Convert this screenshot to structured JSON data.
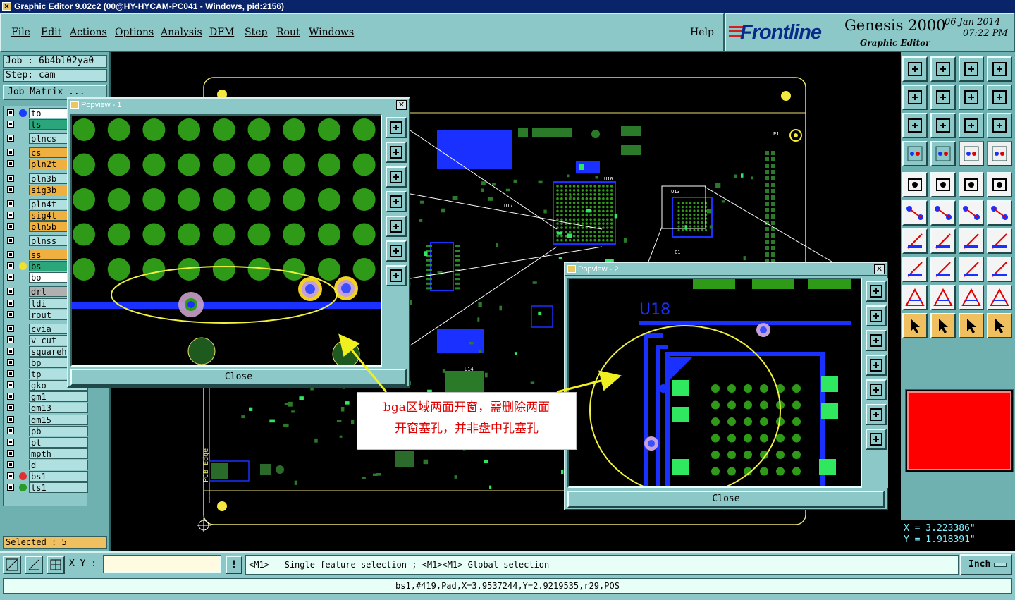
{
  "window": {
    "title": "Graphic Editor 9.02c2 (00@HY-HYCAM-PC041 - Windows, pid:2156)"
  },
  "menu": {
    "items": [
      "File",
      "Edit",
      "Actions",
      "Options",
      "Analysis",
      "DFM",
      "Step",
      "Rout",
      "Windows"
    ],
    "help": "Help"
  },
  "brand": {
    "logo": "Frontline",
    "product": "Genesis 2000",
    "subtitle": "Graphic Editor",
    "date": "06 Jan 2014",
    "time": "07:22 PM"
  },
  "job": {
    "job_label": "Job : 6b4bl02ya0",
    "step_label": "Step: cam",
    "matrix_button": "Job Matrix ..."
  },
  "layers": [
    {
      "name": "to",
      "bg": "#ffffff",
      "dot": "#1a3cff"
    },
    {
      "name": "ts",
      "bg": "#2aa67a",
      "dot": ""
    },
    {
      "name": "plncs",
      "bg": "#b0e0e0",
      "dot": ""
    },
    {
      "name": "cs",
      "bg": "#f0b040",
      "dot": ""
    },
    {
      "name": "pln2t",
      "bg": "#f0b040",
      "dot": ""
    },
    {
      "name": "pln3b",
      "bg": "#b0e0e0",
      "dot": ""
    },
    {
      "name": "sig3b",
      "bg": "#f0b040",
      "dot": ""
    },
    {
      "name": "pln4t",
      "bg": "#b0e0e0",
      "dot": ""
    },
    {
      "name": "sig4t",
      "bg": "#f0b040",
      "dot": ""
    },
    {
      "name": "pln5b",
      "bg": "#f0b040",
      "dot": ""
    },
    {
      "name": "plnss",
      "bg": "#b0e0e0",
      "dot": ""
    },
    {
      "name": "ss",
      "bg": "#f0b040",
      "dot": ""
    },
    {
      "name": "bs",
      "bg": "#2aa67a",
      "dot": "#f0e030"
    },
    {
      "name": "bo",
      "bg": "#ffffff",
      "dot": ""
    },
    {
      "name": "drl",
      "bg": "#b0b0b0",
      "dot": ""
    },
    {
      "name": "ldi",
      "bg": "#b0e0e0",
      "dot": ""
    },
    {
      "name": "rout",
      "bg": "#b0e0e0",
      "dot": ""
    },
    {
      "name": "cvia",
      "bg": "#b0e0e0",
      "dot": ""
    },
    {
      "name": "v-cut",
      "bg": "#b0e0e0",
      "dot": ""
    },
    {
      "name": "squarehole",
      "bg": "#b0e0e0",
      "dot": ""
    },
    {
      "name": "bp",
      "bg": "#b0e0e0",
      "dot": ""
    },
    {
      "name": "tp",
      "bg": "#b0e0e0",
      "dot": ""
    },
    {
      "name": "gko",
      "bg": "#b0e0e0",
      "dot": ""
    },
    {
      "name": "gm1",
      "bg": "#b0e0e0",
      "dot": ""
    },
    {
      "name": "gm13",
      "bg": "#b0e0e0",
      "dot": ""
    },
    {
      "name": "gm15",
      "bg": "#b0e0e0",
      "dot": ""
    },
    {
      "name": "pb",
      "bg": "#b0e0e0",
      "dot": ""
    },
    {
      "name": "pt",
      "bg": "#b0e0e0",
      "dot": ""
    },
    {
      "name": "mpth",
      "bg": "#b0e0e0",
      "dot": ""
    },
    {
      "name": "d",
      "bg": "#b0e0e0",
      "dot": ""
    },
    {
      "name": "bs1",
      "bg": "#b0e0e0",
      "dot": "#e03030"
    },
    {
      "name": "ts1",
      "bg": "#b0e0e0",
      "dot": "#2a9a2a"
    }
  ],
  "selection": {
    "label": "Selected : 5"
  },
  "popview1": {
    "title": "Popview - 1",
    "close": "Close"
  },
  "popview2": {
    "title": "Popview - 2",
    "close": "Close",
    "ref": "U18"
  },
  "canvas": {
    "edge_label": "PCB Edge",
    "ref_labels": [
      "P1",
      "U16",
      "U14",
      "U13",
      "U17",
      "C1"
    ]
  },
  "annotation": {
    "line1": "bga区域两面开窗，需删除两面",
    "line2": "开窗塞孔，并非盘中孔塞孔"
  },
  "coords": {
    "x": "X = 3.223386\"",
    "y": "Y = 1.918391\""
  },
  "bottom": {
    "xy_label": "X Y :",
    "xy_value": "",
    "bang": "!",
    "hint": "<M1> - Single feature selection ; <M1><M1> Global selection",
    "unit": "Inch",
    "status": "bs1,#419,Pad,X=3.9537244,Y=2.9219535,r29,POS"
  },
  "colors": {
    "green_pad": "#2e9a18",
    "blue_trace": "#1a30ff",
    "outline": "#e8e070",
    "bright_green": "#30e860"
  }
}
